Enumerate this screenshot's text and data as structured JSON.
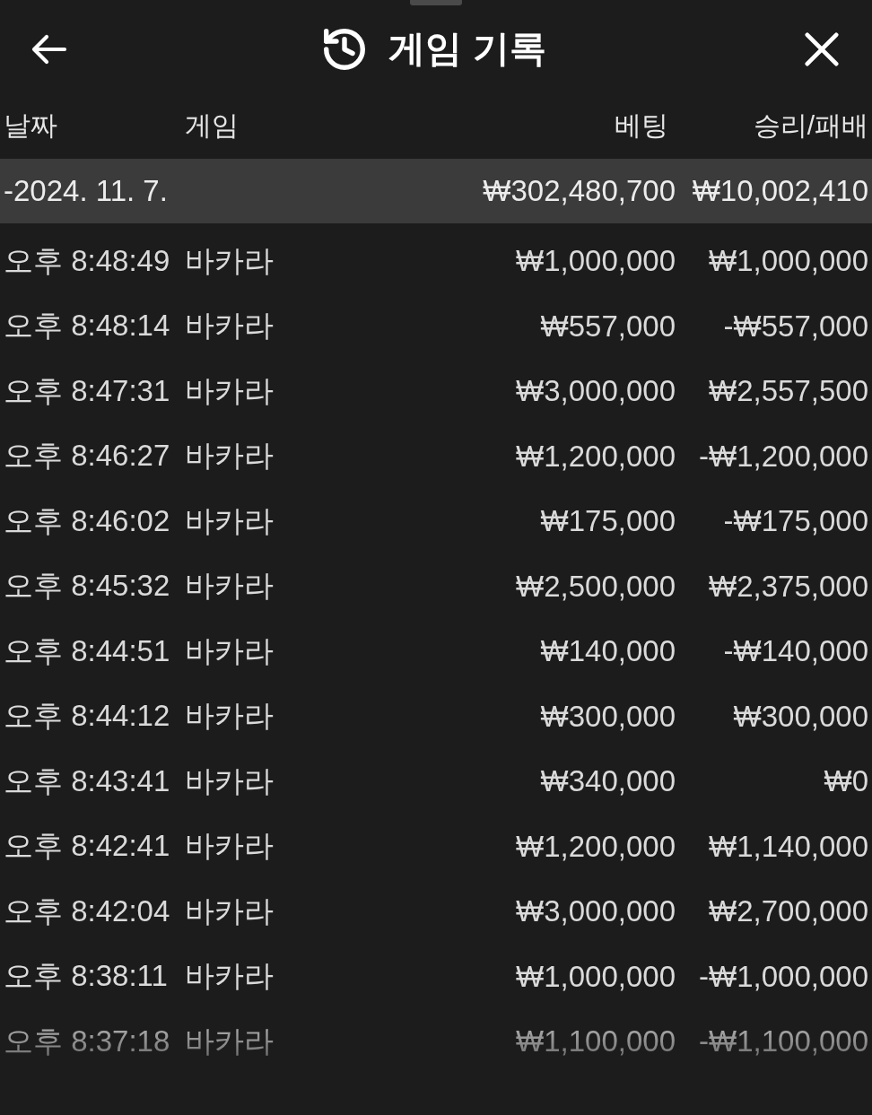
{
  "header": {
    "title": "게임 기록"
  },
  "table": {
    "columns": [
      "날짜",
      "게임",
      "베팅",
      "승리/패배"
    ],
    "summary": {
      "date": "-2024. 11. 7.",
      "bet": "₩302,480,700",
      "result": "₩10,002,410"
    },
    "rows": [
      {
        "time": "오후 8:48:49",
        "game": "바카라",
        "bet": "₩1,000,000",
        "result": "₩1,000,000"
      },
      {
        "time": "오후 8:48:14",
        "game": "바카라",
        "bet": "₩557,000",
        "result": "-₩557,000"
      },
      {
        "time": "오후 8:47:31",
        "game": "바카라",
        "bet": "₩3,000,000",
        "result": "₩2,557,500"
      },
      {
        "time": "오후 8:46:27",
        "game": "바카라",
        "bet": "₩1,200,000",
        "result": "-₩1,200,000"
      },
      {
        "time": "오후 8:46:02",
        "game": "바카라",
        "bet": "₩175,000",
        "result": "-₩175,000"
      },
      {
        "time": "오후 8:45:32",
        "game": "바카라",
        "bet": "₩2,500,000",
        "result": "₩2,375,000"
      },
      {
        "time": "오후 8:44:51",
        "game": "바카라",
        "bet": "₩140,000",
        "result": "-₩140,000"
      },
      {
        "time": "오후 8:44:12",
        "game": "바카라",
        "bet": "₩300,000",
        "result": "₩300,000"
      },
      {
        "time": "오후 8:43:41",
        "game": "바카라",
        "bet": "₩340,000",
        "result": "₩0"
      },
      {
        "time": "오후 8:42:41",
        "game": "바카라",
        "bet": "₩1,200,000",
        "result": "₩1,140,000"
      },
      {
        "time": "오후 8:42:04",
        "game": "바카라",
        "bet": "₩3,000,000",
        "result": "₩2,700,000"
      },
      {
        "time": "오후 8:38:11",
        "game": "바카라",
        "bet": "₩1,000,000",
        "result": "-₩1,000,000"
      },
      {
        "time": "오후 8:37:18",
        "game": "바카라",
        "bet": "₩1,100,000",
        "result": "-₩1,100,000"
      }
    ]
  }
}
